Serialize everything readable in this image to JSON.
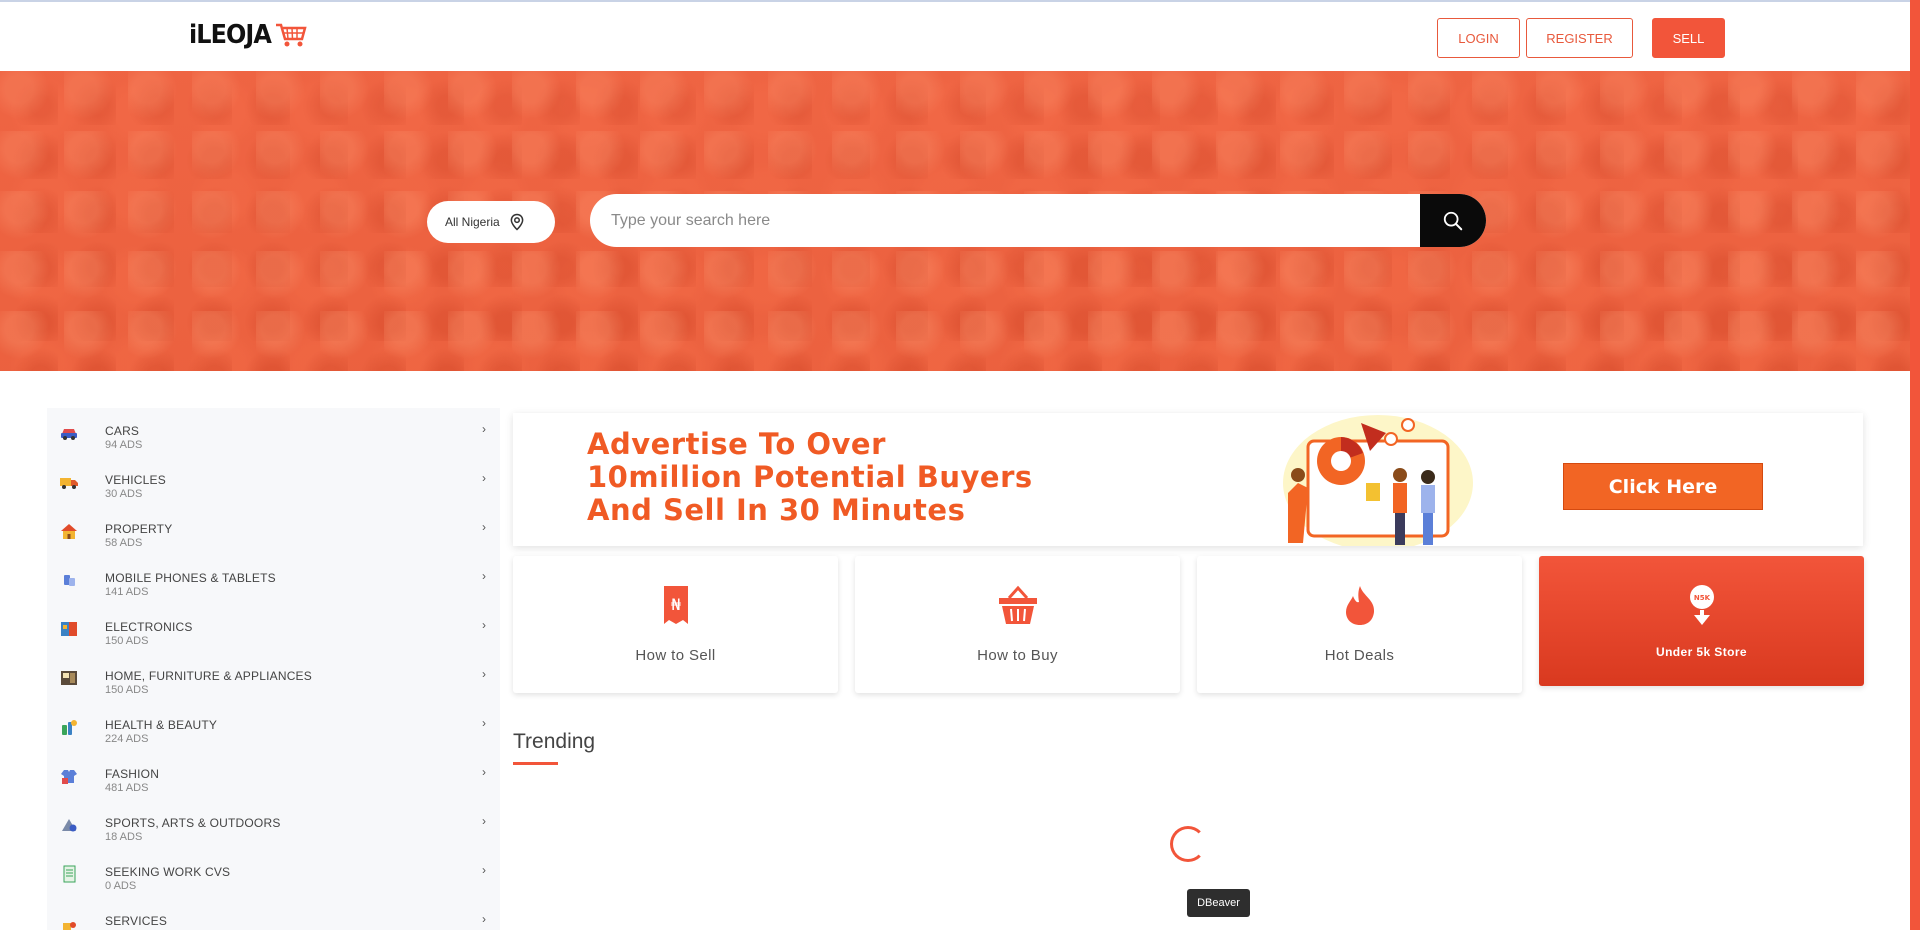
{
  "header": {
    "logo_text": "iLEOJA",
    "login_label": "LOGIN",
    "register_label": "REGISTER",
    "sell_label": "SELL"
  },
  "hero": {
    "location_label": "All Nigeria",
    "search_placeholder": "Type your search here"
  },
  "categories": [
    {
      "name": "CARS",
      "count": "94 ADS",
      "icon": "car-icon"
    },
    {
      "name": "VEHICLES",
      "count": "30 ADS",
      "icon": "truck-icon"
    },
    {
      "name": "PROPERTY",
      "count": "58 ADS",
      "icon": "house-icon"
    },
    {
      "name": "MOBILE PHONES & TABLETS",
      "count": "141 ADS",
      "icon": "phone-icon"
    },
    {
      "name": "ELECTRONICS",
      "count": "150 ADS",
      "icon": "electronics-icon"
    },
    {
      "name": "HOME, FURNITURE & APPLIANCES",
      "count": "150 ADS",
      "icon": "furniture-icon"
    },
    {
      "name": "HEALTH & BEAUTY",
      "count": "224 ADS",
      "icon": "beauty-icon"
    },
    {
      "name": "FASHION",
      "count": "481 ADS",
      "icon": "fashion-icon"
    },
    {
      "name": "SPORTS, ARTS & OUTDOORS",
      "count": "18 ADS",
      "icon": "sports-icon"
    },
    {
      "name": "SEEKING WORK CVS",
      "count": "0 ADS",
      "icon": "cv-icon"
    },
    {
      "name": "SERVICES",
      "count": "",
      "icon": "services-icon"
    }
  ],
  "banner": {
    "line1": "Advertise To Over",
    "line2": "10million Potential Buyers",
    "line3": "And Sell In 30 Minutes",
    "cta": "Click Here"
  },
  "quick_cards": {
    "sell": "How to Sell",
    "buy": "How to Buy",
    "deals": "Hot Deals",
    "under5k": "Under 5k Store",
    "under5k_badge": "N5K"
  },
  "trending": {
    "title": "Trending"
  },
  "tooltip": "DBeaver",
  "colors": {
    "accent": "#f2553a",
    "banner_orange": "#f05a24",
    "sidebar_bg": "#f7f8fa"
  }
}
